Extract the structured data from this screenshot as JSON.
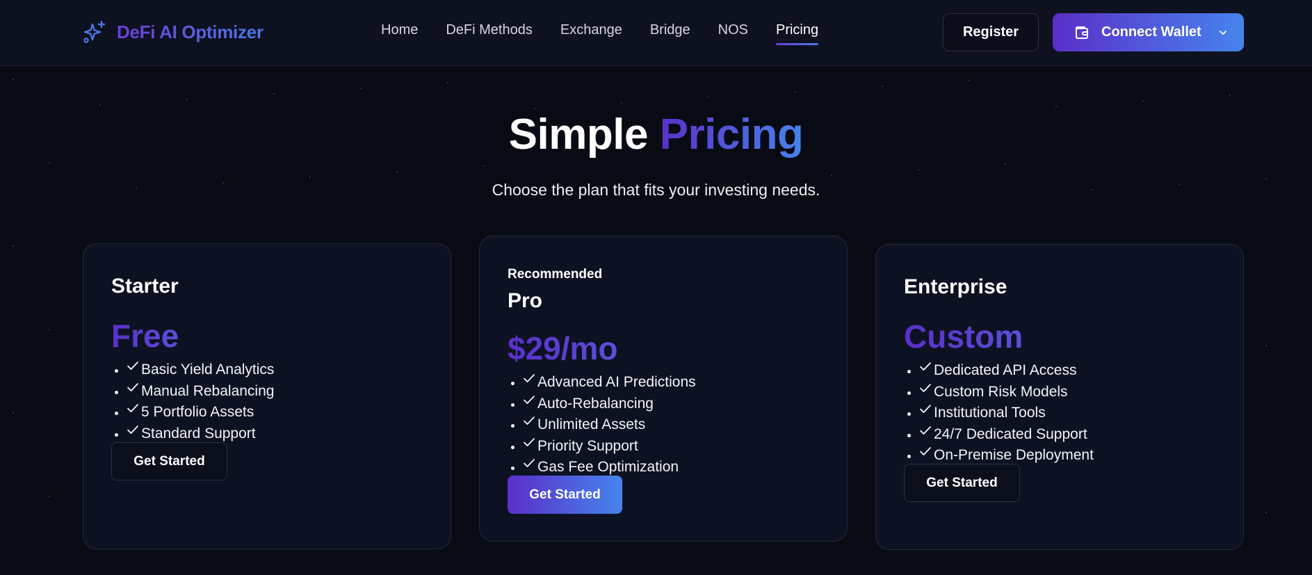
{
  "brand": {
    "name": "DeFi AI Optimizer",
    "icon": "sparkles-icon"
  },
  "nav": {
    "links": [
      {
        "label": "Home",
        "active": false
      },
      {
        "label": "DeFi Methods",
        "active": false
      },
      {
        "label": "Exchange",
        "active": false
      },
      {
        "label": "Bridge",
        "active": false
      },
      {
        "label": "NOS",
        "active": false
      },
      {
        "label": "Pricing",
        "active": true
      }
    ],
    "register_label": "Register",
    "wallet_label": "Connect Wallet",
    "wallet_icon": "wallet-icon"
  },
  "hero": {
    "title_plain": "Simple",
    "title_accent": "Pricing",
    "subtitle": "Choose the plan that fits your investing needs."
  },
  "plans": [
    {
      "tag": "",
      "name": "Starter",
      "price": "Free",
      "features": [
        "Basic Yield Analytics",
        "Manual Rebalancing",
        "5 Portfolio Assets",
        "Standard Support"
      ],
      "cta": "Get Started"
    },
    {
      "tag": "Recommended",
      "name": "Pro",
      "price": "$29/mo",
      "features": [
        "Advanced AI Predictions",
        "Auto-Rebalancing",
        "Unlimited Assets",
        "Priority Support",
        "Gas Fee Optimization"
      ],
      "cta": "Get Started"
    },
    {
      "tag": "",
      "name": "Enterprise",
      "price": "Custom",
      "features": [
        "Dedicated API Access",
        "Custom Risk Models",
        "Institutional Tools",
        "24/7 Dedicated Support",
        "On-Premise Deployment"
      ],
      "cta": "Get Started"
    }
  ],
  "colors": {
    "background": "#090b14",
    "nav_background": "#0d1120",
    "card_background": "#0d1222",
    "accent_start": "#5a2fc9",
    "accent_end": "#4684ec"
  }
}
